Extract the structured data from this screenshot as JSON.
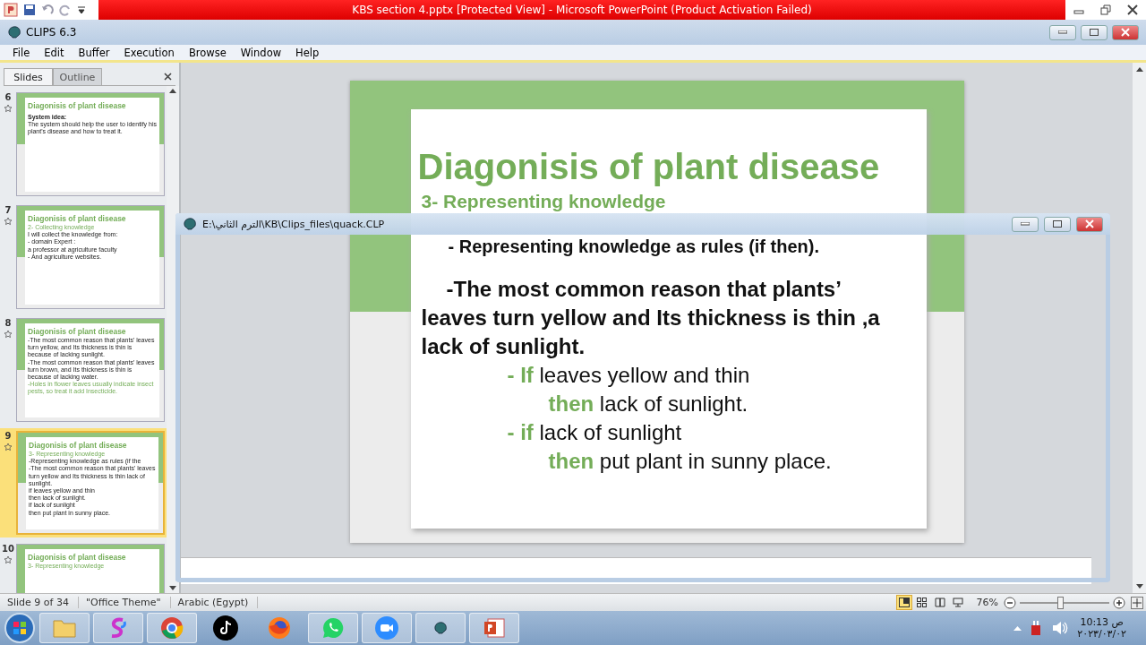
{
  "app_title_bar": {
    "title": "KBS section 4.pptx [Protected View]  -  Microsoft PowerPoint (Product Activation Failed)"
  },
  "clips_window": {
    "title": "CLIPS 6.3",
    "menu": [
      "File",
      "Edit",
      "Buffer",
      "Execution",
      "Browse",
      "Window",
      "Help"
    ]
  },
  "panel_tabs": [
    {
      "label": "Slides",
      "selected": true
    },
    {
      "label": "Outline",
      "selected": false
    }
  ],
  "thumbnails": [
    {
      "number": "6",
      "selected": false,
      "title": "Diagonisis of plant disease",
      "lines": [
        {
          "kind": "heading",
          "text": "System idea:"
        },
        {
          "kind": "text",
          "text": "The system should help the user to identify his plant's disease and how to treat it."
        }
      ]
    },
    {
      "number": "7",
      "selected": false,
      "title": "Diagonisis of plant disease",
      "lines": [
        {
          "kind": "subtitle",
          "text": "2- Collecting knowledge"
        },
        {
          "kind": "text",
          "text": "I will collect the knowledge from:"
        },
        {
          "kind": "text",
          "text": "- domain Expert :"
        },
        {
          "kind": "text",
          "text": "a professor at agriculture faculty"
        },
        {
          "kind": "text",
          "text": "- And agriculture websites."
        }
      ]
    },
    {
      "number": "8",
      "selected": false,
      "title": "Diagonisis of plant disease",
      "lines": [
        {
          "kind": "text",
          "text": "-The most common reason that plants' leaves turn yellow, and Its thickness is thin is because of lacking sunlight."
        },
        {
          "kind": "text",
          "text": "-The most common reason that plants' leaves turn brown, and Its thickness is thin is because of lacking water."
        },
        {
          "kind": "subtitle",
          "text": "-Holes in flower leaves usually indicate insect pests, so treat it add Insecticide."
        }
      ]
    },
    {
      "number": "9",
      "selected": true,
      "title": "Diagonisis of plant disease",
      "lines": [
        {
          "kind": "subtitle",
          "text": "3- Representing knowledge"
        },
        {
          "kind": "text",
          "text": "-Representing knowledge as rules (if the"
        },
        {
          "kind": "text",
          "text": "-The most common reason that plants' leaves turn yellow and Its thickness is thin lack of sunlight."
        },
        {
          "kind": "text",
          "text": "if leaves yellow and thin"
        },
        {
          "kind": "text",
          "text": "then lack of sunlight."
        },
        {
          "kind": "text",
          "text": "if lack of sunlight"
        },
        {
          "kind": "text",
          "text": "then put plant in sunny place."
        }
      ]
    },
    {
      "number": "10",
      "selected": false,
      "title": "Diagonisis of plant disease",
      "lines": [
        {
          "kind": "subtitle",
          "text": "3- Representing knowledge"
        }
      ]
    }
  ],
  "slide": {
    "title": "Diagonisis of plant disease",
    "subtitle": "3- Representing knowledge",
    "lines": [
      {
        "kind": "bullet",
        "text": "- Representing knowledge as rules (if then)."
      },
      {
        "kind": "para",
        "text": "-The most common reason that plants’ leaves turn yellow and Its thickness is thin ,a lack of sunlight."
      },
      {
        "kind": "rule",
        "keyword": "- If",
        "text": "leaves yellow and thin"
      },
      {
        "kind": "then",
        "keyword": "then",
        "text": "lack of sunlight."
      },
      {
        "kind": "rule",
        "keyword": "- if",
        "text": "lack of sunlight"
      },
      {
        "kind": "then",
        "keyword": "then",
        "text": "put plant in sunny place."
      }
    ]
  },
  "editor_window": {
    "title": "E:\\الترم الثاني\\KB\\Clips_files\\quack.CLP"
  },
  "status_bar": [
    "Slide 9 of 34",
    "\"Office Theme\"",
    "Arabic (Egypt)"
  ],
  "zoom": {
    "reading": "76%",
    "level": 0.45
  },
  "clock": {
    "time": "ص 10:13",
    "date": "٢٠٢٣/٠٣/٠٢"
  }
}
